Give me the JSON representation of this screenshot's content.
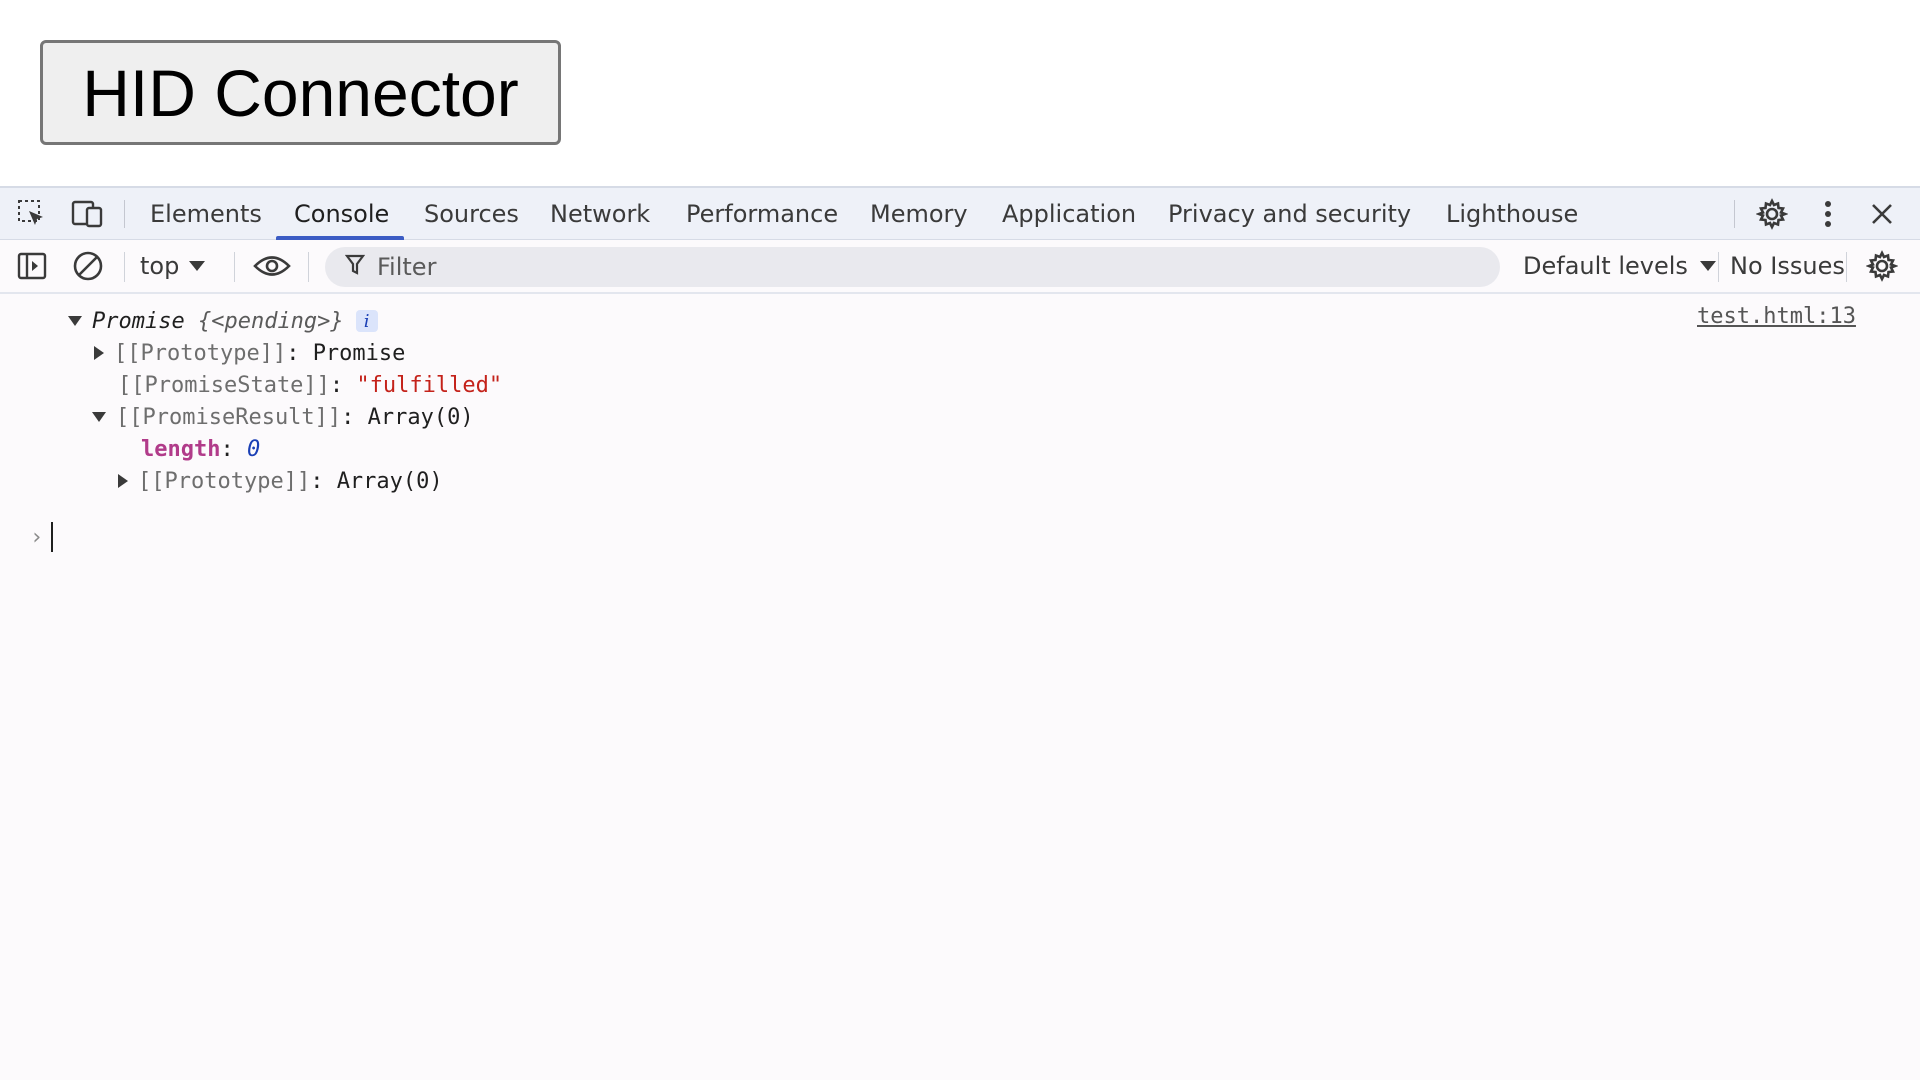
{
  "page": {
    "button_label": "HID Connector"
  },
  "devtools": {
    "tabs": [
      {
        "label": "Elements"
      },
      {
        "label": "Console"
      },
      {
        "label": "Sources"
      },
      {
        "label": "Network"
      },
      {
        "label": "Performance"
      },
      {
        "label": "Memory"
      },
      {
        "label": "Application"
      },
      {
        "label": "Privacy and security"
      },
      {
        "label": "Lighthouse"
      }
    ],
    "active_tab": "Console",
    "filterbar": {
      "context": "top",
      "filter_placeholder": "Filter",
      "levels": "Default levels",
      "issues": "No Issues"
    },
    "console": {
      "source": "test.html:13",
      "promise_label": "Promise",
      "promise_state_preview": "{<pending>}",
      "info_badge": "i",
      "entries": [
        {
          "key": "[[Prototype]]",
          "sep": ": ",
          "value": "Promise"
        },
        {
          "key": "[[PromiseState]]",
          "sep": ": ",
          "value": "\"fulfilled\""
        },
        {
          "key": "[[PromiseResult]]",
          "sep": ": ",
          "value": "Array(0)"
        }
      ],
      "result_children": [
        {
          "key": "length",
          "sep": ": ",
          "value": "0"
        },
        {
          "key": "[[Prototype]]",
          "sep": ": ",
          "value": "Array(0)"
        }
      ],
      "prompt_symbol": "›"
    },
    "colors": {
      "accent": "#3b5cc4",
      "string": "#c4221a",
      "number": "#1a3fb5",
      "own_key": "#b13b8a"
    },
    "icons": [
      "inspect-element-icon",
      "device-toolbar-icon",
      "settings-gear-icon",
      "more-options-icon",
      "close-icon",
      "sidebar-toggle-icon",
      "clear-console-icon",
      "live-expression-eye-icon",
      "filter-funnel-icon",
      "console-settings-gear-icon"
    ]
  }
}
